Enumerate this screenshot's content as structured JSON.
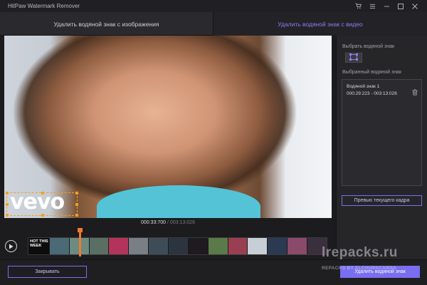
{
  "window": {
    "title": "HitPaw Watermark Remover"
  },
  "tabs": [
    {
      "label": "Удалить водяной знак с изображения",
      "active": false
    },
    {
      "label": "Удалить водяной знак с видео",
      "active": true
    }
  ],
  "video": {
    "watermark_text": "vevo",
    "time_current": "000:33:700",
    "time_separator": "/",
    "time_total": "003:13:026",
    "timeline_thumbnail_text": "HOT THIS WEEK",
    "playhead_progress": 0.17
  },
  "panel": {
    "select_label": "Выбрать водяной знак",
    "selected_label": "Выбранный водяной знак",
    "items": [
      {
        "name": "Водяной знак 1",
        "range": "000:29:223 - 003:13:026"
      }
    ],
    "preview_button": "Превью текущего кадра"
  },
  "footer": {
    "close_button": "Закрывать",
    "remove_button": "Удалить водяной знак"
  },
  "overlay": {
    "site": "lrepacks.ru",
    "site_sub": "REPACKS BY ELCHUPACABRA"
  },
  "colors": {
    "accent": "#7a6ef0",
    "active_tab_text": "#8d7df5",
    "selection": "#f0a122",
    "playhead": "#f07a2a",
    "background": "#1c1c1f"
  },
  "icons": [
    "cart-icon",
    "menu-icon",
    "minimize-icon",
    "maximize-icon",
    "close-icon",
    "selection-tool-icon",
    "trash-icon",
    "play-icon"
  ]
}
